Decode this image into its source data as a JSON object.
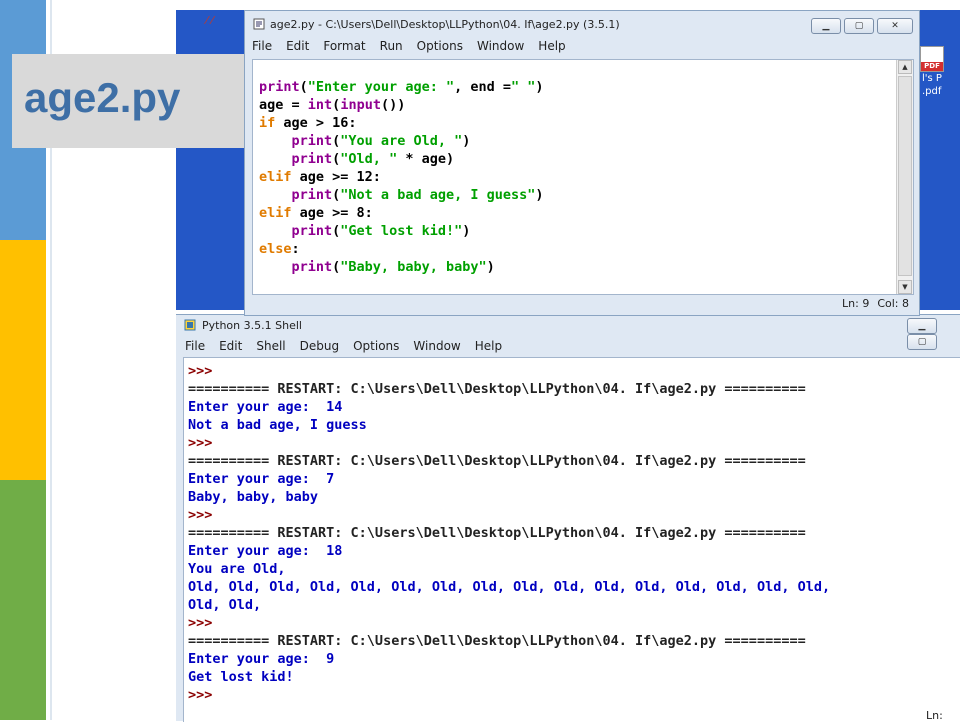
{
  "slide": {
    "title": "age2.py"
  },
  "desktop": {
    "pdf_badge": "PDF",
    "pdf_label_line1": "l's P",
    "pdf_label_line2": ".pdf"
  },
  "editor": {
    "title": "age2.py - C:\\Users\\Dell\\Desktop\\LLPython\\04. If\\age2.py (3.5.1)",
    "menu": [
      "File",
      "Edit",
      "Format",
      "Run",
      "Options",
      "Window",
      "Help"
    ],
    "status": {
      "line": "Ln: 9",
      "col": "Col: 8"
    }
  },
  "shell": {
    "title": "Python 3.5.1 Shell",
    "menu": [
      "File",
      "Edit",
      "Shell",
      "Debug",
      "Options",
      "Window",
      "Help"
    ],
    "lines": [
      {
        "text": ">>>",
        "kind": "prompt"
      },
      {
        "text": "========== RESTART: C:\\Users\\Dell\\Desktop\\LLPython\\04. If\\age2.py ==========",
        "kind": "restart"
      },
      {
        "text": "Enter your age:  14",
        "kind": "out"
      },
      {
        "text": "Not a bad age, I guess",
        "kind": "out"
      },
      {
        "text": ">>>",
        "kind": "prompt"
      },
      {
        "text": "========== RESTART: C:\\Users\\Dell\\Desktop\\LLPython\\04. If\\age2.py ==========",
        "kind": "restart"
      },
      {
        "text": "Enter your age:  7",
        "kind": "out"
      },
      {
        "text": "Baby, baby, baby",
        "kind": "out"
      },
      {
        "text": ">>>",
        "kind": "prompt"
      },
      {
        "text": "========== RESTART: C:\\Users\\Dell\\Desktop\\LLPython\\04. If\\age2.py ==========",
        "kind": "restart"
      },
      {
        "text": "Enter your age:  18",
        "kind": "out"
      },
      {
        "text": "You are Old,",
        "kind": "out"
      },
      {
        "text": "Old, Old, Old, Old, Old, Old, Old, Old, Old, Old, Old, Old, Old, Old, Old, Old,",
        "kind": "out"
      },
      {
        "text": "Old, Old,",
        "kind": "out"
      },
      {
        "text": ">>>",
        "kind": "prompt"
      },
      {
        "text": "========== RESTART: C:\\Users\\Dell\\Desktop\\LLPython\\04. If\\age2.py ==========",
        "kind": "restart"
      },
      {
        "text": "Enter your age:  9",
        "kind": "out"
      },
      {
        "text": "Get lost kid!",
        "kind": "out"
      },
      {
        "text": ">>>",
        "kind": "prompt"
      }
    ],
    "status": "Ln:"
  },
  "code_lines": [
    [
      [
        "bi",
        "print"
      ],
      [
        "pl",
        "("
      ],
      [
        "st",
        "\"Enter your age: \""
      ],
      [
        "pl",
        ", end ="
      ],
      [
        "st",
        "\" \""
      ],
      [
        "pl",
        ")"
      ]
    ],
    [
      [
        "pl",
        "age = "
      ],
      [
        "bi",
        "int"
      ],
      [
        "pl",
        "("
      ],
      [
        "bi",
        "input"
      ],
      [
        "pl",
        "())"
      ]
    ],
    [
      [
        "kw",
        "if"
      ],
      [
        "pl",
        " age > 16:"
      ]
    ],
    [
      [
        "pl",
        "    "
      ],
      [
        "bi",
        "print"
      ],
      [
        "pl",
        "("
      ],
      [
        "st",
        "\"You are Old, \""
      ],
      [
        "pl",
        ")"
      ]
    ],
    [
      [
        "pl",
        "    "
      ],
      [
        "bi",
        "print"
      ],
      [
        "pl",
        "("
      ],
      [
        "st",
        "\"Old, \""
      ],
      [
        "pl",
        " * age)"
      ]
    ],
    [
      [
        "kw",
        "elif"
      ],
      [
        "pl",
        " age >= 12:"
      ]
    ],
    [
      [
        "pl",
        "    "
      ],
      [
        "bi",
        "print"
      ],
      [
        "pl",
        "("
      ],
      [
        "st",
        "\"Not a bad age, I guess\""
      ],
      [
        "pl",
        ")"
      ]
    ],
    [
      [
        "kw",
        "elif"
      ],
      [
        "pl",
        " age >= 8:"
      ]
    ],
    [
      [
        "pl",
        "    "
      ],
      [
        "bi",
        "print"
      ],
      [
        "pl",
        "("
      ],
      [
        "st",
        "\"Get lost kid!\""
      ],
      [
        "pl",
        ")"
      ]
    ],
    [
      [
        "kw",
        "else"
      ],
      [
        "pl",
        ":"
      ]
    ],
    [
      [
        "pl",
        "    "
      ],
      [
        "bi",
        "print"
      ],
      [
        "pl",
        "("
      ],
      [
        "st",
        "\"Baby, baby, baby\""
      ],
      [
        "pl",
        ")"
      ]
    ]
  ]
}
